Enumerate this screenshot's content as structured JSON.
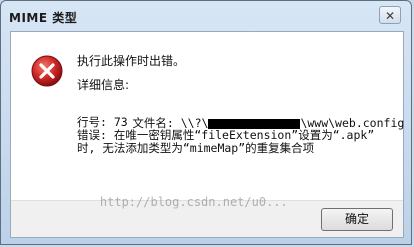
{
  "window": {
    "title": "MIME 类型",
    "close_label": "✕"
  },
  "message": {
    "header": "执行此操作时出错。",
    "details_label": "详细信息:",
    "filename_prefix": "文件名: \\\\?\\",
    "filename_suffix": "\\www\\web.config",
    "line_number": "行号: 73",
    "error_line1": "错误: 在唯一密钥属性“fileExtension”设置为“.apk”",
    "error_line2": "时, 无法添加类型为“mimeMap”的重复集合项"
  },
  "footer": {
    "ok_label": "确定"
  },
  "watermark": {
    "text": "http://blog.csdn.net/u0",
    "suffix": "..."
  },
  "icons": {
    "error": "error-icon"
  },
  "colors": {
    "error_red": "#d12b2b",
    "titlebar": "#c9d9ea"
  }
}
